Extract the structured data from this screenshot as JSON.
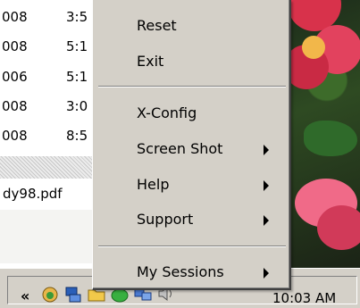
{
  "file_list": {
    "rows": [
      {
        "c1": "008",
        "c2": "3:5"
      },
      {
        "c1": "008",
        "c2": "5:1"
      },
      {
        "c1": "006",
        "c2": "5:1"
      },
      {
        "c1": "008",
        "c2": "3:0"
      },
      {
        "c1": "008",
        "c2": "8:5"
      }
    ],
    "filename": "dy98.pdf"
  },
  "menu": {
    "items": [
      {
        "label": "Reset"
      },
      {
        "label": "Exit"
      },
      {
        "label": "X-Config"
      },
      {
        "label": "Screen Shot"
      },
      {
        "label": "Help"
      },
      {
        "label": "Support"
      },
      {
        "label": "My Sessions"
      }
    ]
  },
  "taskbar": {
    "chevron": "«",
    "clock": "10:03 AM",
    "icons": [
      "hand-icon",
      "network-icon",
      "folder-icon",
      "green-app-icon",
      "network-connection-icon",
      "speaker-icon"
    ]
  },
  "colors": {
    "menu_bg": "#d4d0c8",
    "taskbar_bg": "#d4d0c8",
    "flower_red": "#d8324b",
    "flower_pink": "#f06a88"
  }
}
